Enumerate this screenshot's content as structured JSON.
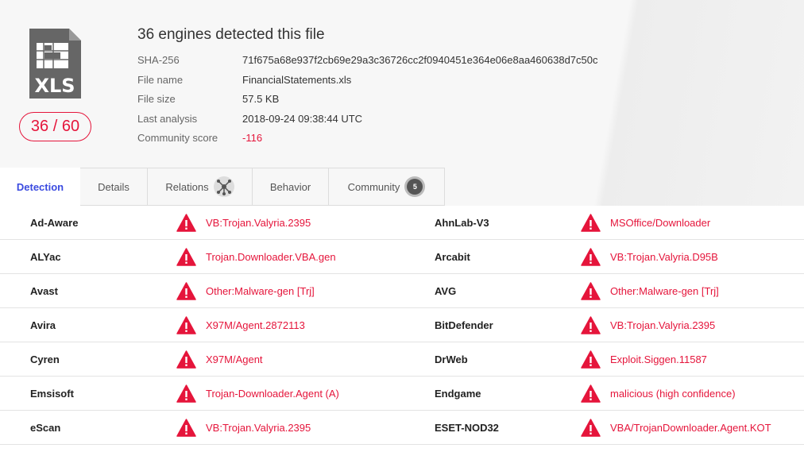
{
  "file": {
    "type_label": "XLS",
    "score": "36 / 60",
    "title": "36 engines detected this file",
    "info": [
      {
        "label": "SHA-256",
        "value": "71f675a68e937f2cb69e29a3c36726cc2f0940451e364e06e8aa460638d7c50c"
      },
      {
        "label": "File name",
        "value": "FinancialStatements.xls"
      },
      {
        "label": "File size",
        "value": "57.5 KB"
      },
      {
        "label": "Last analysis",
        "value": "2018-09-24 09:38:44 UTC"
      },
      {
        "label": "Community score",
        "value": "-116"
      }
    ]
  },
  "tabs": [
    {
      "label": "Detection",
      "active": true
    },
    {
      "label": "Details"
    },
    {
      "label": "Relations",
      "icon": "graph-icon"
    },
    {
      "label": "Behavior"
    },
    {
      "label": "Community",
      "badge": "5"
    }
  ],
  "detections": [
    {
      "engine": "Ad-Aware",
      "result": "VB:Trojan.Valyria.2395",
      "engine2": "AhnLab-V3",
      "result2": "MSOffice/Downloader"
    },
    {
      "engine": "ALYac",
      "result": "Trojan.Downloader.VBA.gen",
      "engine2": "Arcabit",
      "result2": "VB:Trojan.Valyria.D95B"
    },
    {
      "engine": "Avast",
      "result": "Other:Malware-gen [Trj]",
      "engine2": "AVG",
      "result2": "Other:Malware-gen [Trj]"
    },
    {
      "engine": "Avira",
      "result": "X97M/Agent.2872113",
      "engine2": "BitDefender",
      "result2": "VB:Trojan.Valyria.2395"
    },
    {
      "engine": "Cyren",
      "result": "X97M/Agent",
      "engine2": "DrWeb",
      "result2": "Exploit.Siggen.11587"
    },
    {
      "engine": "Emsisoft",
      "result": "Trojan-Downloader.Agent (A)",
      "engine2": "Endgame",
      "result2": "malicious (high confidence)"
    },
    {
      "engine": "eScan",
      "result": "VB:Trojan.Valyria.2395",
      "engine2": "ESET-NOD32",
      "result2": "VBA/TrojanDownloader.Agent.KOT"
    }
  ],
  "colors": {
    "alert": "#e5153b",
    "active_tab": "#3b4be0"
  }
}
